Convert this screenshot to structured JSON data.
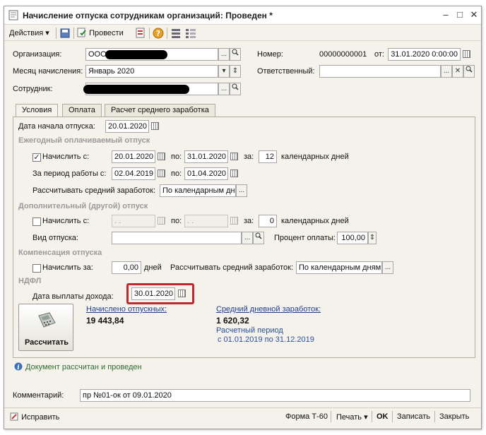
{
  "window": {
    "title": "Начисление отпуска сотрудникам организаций: Проведен *",
    "controls": {
      "minimize": "–",
      "maximize": "□",
      "close": "✕"
    }
  },
  "toolbar": {
    "actions_label": "Действия",
    "post_label": "Провести"
  },
  "header": {
    "org_label": "Организация:",
    "org_value": "ООО",
    "month_label": "Месяц начисления:",
    "month_value": "Январь 2020",
    "employee_label": "Сотрудник:",
    "number_label": "Номер:",
    "number_value": "00000000001",
    "from_label": "от:",
    "date_value": "31.01.2020 0:00:00",
    "responsible_label": "Ответственный:",
    "responsible_value": ""
  },
  "tabs": [
    {
      "label": "Условия"
    },
    {
      "label": "Оплата"
    },
    {
      "label": "Расчет среднего заработка"
    }
  ],
  "conditions": {
    "start_label": "Дата начала отпуска:",
    "start_value": "20.01.2020",
    "annual": {
      "section_title": "Ежегодный оплачиваемый отпуск",
      "accrue_label": "Начислить с:",
      "accrue_checked": true,
      "from_value": "20.01.2020",
      "to_label": "по:",
      "to_value": "31.01.2020",
      "for_label": "за:",
      "days_value": "12",
      "days_unit": "календарных дней",
      "period_label": "За период работы с:",
      "period_from": "02.04.2019",
      "period_to_label": "по:",
      "period_to": "01.04.2020",
      "avg_label": "Рассчитывать средний заработок:",
      "avg_value": "По календарным дня"
    },
    "additional": {
      "section_title": "Дополнительный (другой) отпуск",
      "accrue_label": "Начислить с:",
      "from_value": " .  .",
      "to_label": "по:",
      "to_value": " .  .",
      "for_label": "за:",
      "days_value": "0",
      "days_unit": "календарных дней",
      "type_label": "Вид отпуска:",
      "type_value": "",
      "pct_label": "Процент оплаты:",
      "pct_value": "100,00"
    },
    "compensation": {
      "section_title": "Компенсация отпуска",
      "accrue_label": "Начислить за:",
      "days_value": "0,00",
      "days_unit": "дней",
      "avg_label": "Рассчитывать средний заработок:",
      "avg_value": "По календарным дням"
    },
    "ndfl": {
      "section_title": "НДФЛ",
      "pay_date_label": "Дата выплаты дохода:",
      "pay_date_value": "30.01.2020"
    },
    "calc_button_label": "Рассчитать",
    "accrued_label": "Начислено отпускных:",
    "accrued_value": "19 443,84",
    "avg_daily_label": "Средний дневной заработок:",
    "avg_daily_value": "1 620,32",
    "calc_period_label": "Расчетный период",
    "calc_period_value": "с 01.01.2019 по 31.12.2019"
  },
  "status_message": "Документ рассчитан и проведен",
  "comment": {
    "label": "Комментарий:",
    "value": "пр №01-ок от 09.01.2020"
  },
  "bottom": {
    "fix_label": "Исправить",
    "form_label": "Форма Т-60",
    "print_label": "Печать",
    "ok_label": "OK",
    "save_label": "Записать",
    "close_label": "Закрыть"
  },
  "colors": {
    "highlight_border": "#c0282d",
    "link": "#1f3f8f",
    "window_bg": "#f4f2ea"
  }
}
